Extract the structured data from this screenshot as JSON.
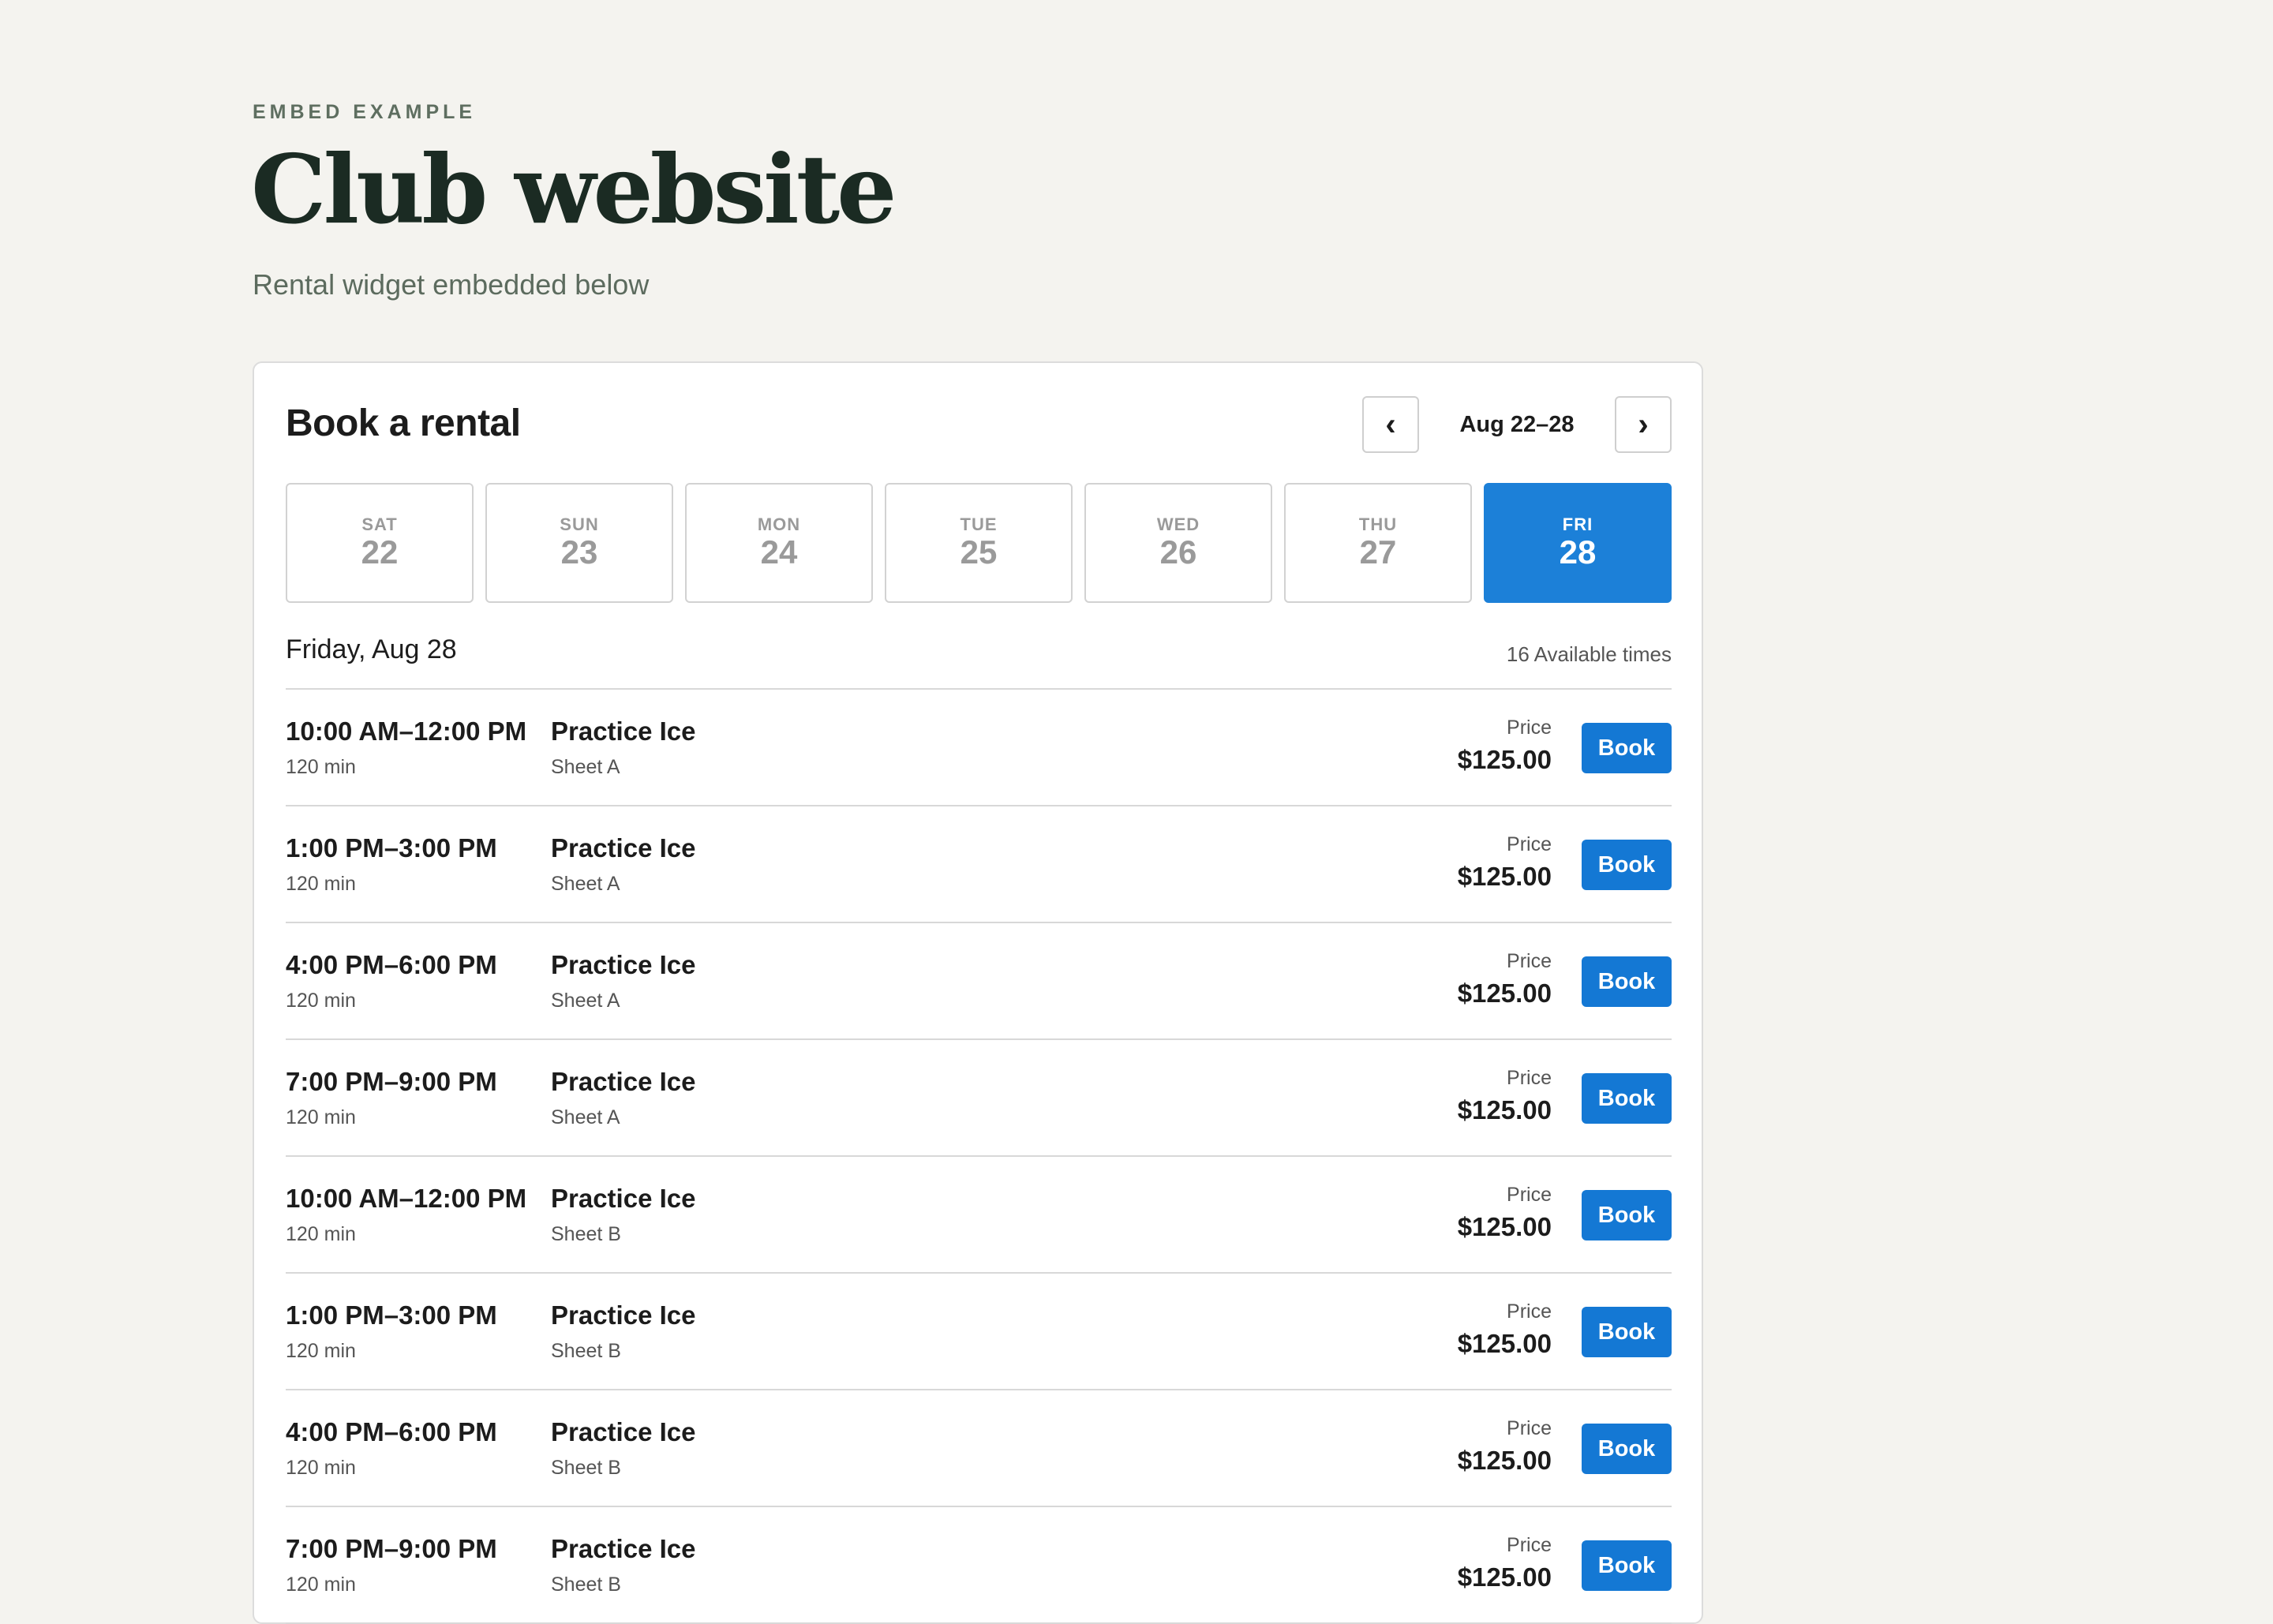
{
  "header": {
    "eyebrow": "EMBED EXAMPLE",
    "title": "Club website",
    "subtitle": "Rental widget embedded below"
  },
  "widget": {
    "title": "Book a rental",
    "prev_icon": "chevron-left-icon",
    "next_icon": "chevron-right-icon",
    "prev_symbol": "‹",
    "next_symbol": "›",
    "range_label": "Aug 22–28",
    "days": [
      {
        "dow": "SAT",
        "num": "22",
        "selected": false
      },
      {
        "dow": "SUN",
        "num": "23",
        "selected": false
      },
      {
        "dow": "MON",
        "num": "24",
        "selected": false
      },
      {
        "dow": "TUE",
        "num": "25",
        "selected": false
      },
      {
        "dow": "WED",
        "num": "26",
        "selected": false
      },
      {
        "dow": "THU",
        "num": "27",
        "selected": false
      },
      {
        "dow": "FRI",
        "num": "28",
        "selected": true
      }
    ],
    "date_heading": "Friday, Aug 28",
    "available_count": "16",
    "available_label": "Available times",
    "price_label": "Price",
    "book_label": "Book",
    "colors": {
      "accent": "#1c80d8",
      "button": "#1478d4",
      "background": "#f4f3ef"
    },
    "slots": [
      {
        "time": "10:00 AM–12:00 PM",
        "duration": "120 min",
        "name": "Practice Ice",
        "sheet": "Sheet A",
        "price": "$125.00"
      },
      {
        "time": "1:00 PM–3:00 PM",
        "duration": "120 min",
        "name": "Practice Ice",
        "sheet": "Sheet A",
        "price": "$125.00"
      },
      {
        "time": "4:00 PM–6:00 PM",
        "duration": "120 min",
        "name": "Practice Ice",
        "sheet": "Sheet A",
        "price": "$125.00"
      },
      {
        "time": "7:00 PM–9:00 PM",
        "duration": "120 min",
        "name": "Practice Ice",
        "sheet": "Sheet A",
        "price": "$125.00"
      },
      {
        "time": "10:00 AM–12:00 PM",
        "duration": "120 min",
        "name": "Practice Ice",
        "sheet": "Sheet B",
        "price": "$125.00"
      },
      {
        "time": "1:00 PM–3:00 PM",
        "duration": "120 min",
        "name": "Practice Ice",
        "sheet": "Sheet B",
        "price": "$125.00"
      },
      {
        "time": "4:00 PM–6:00 PM",
        "duration": "120 min",
        "name": "Practice Ice",
        "sheet": "Sheet B",
        "price": "$125.00"
      },
      {
        "time": "7:00 PM–9:00 PM",
        "duration": "120 min",
        "name": "Practice Ice",
        "sheet": "Sheet B",
        "price": "$125.00"
      }
    ]
  }
}
